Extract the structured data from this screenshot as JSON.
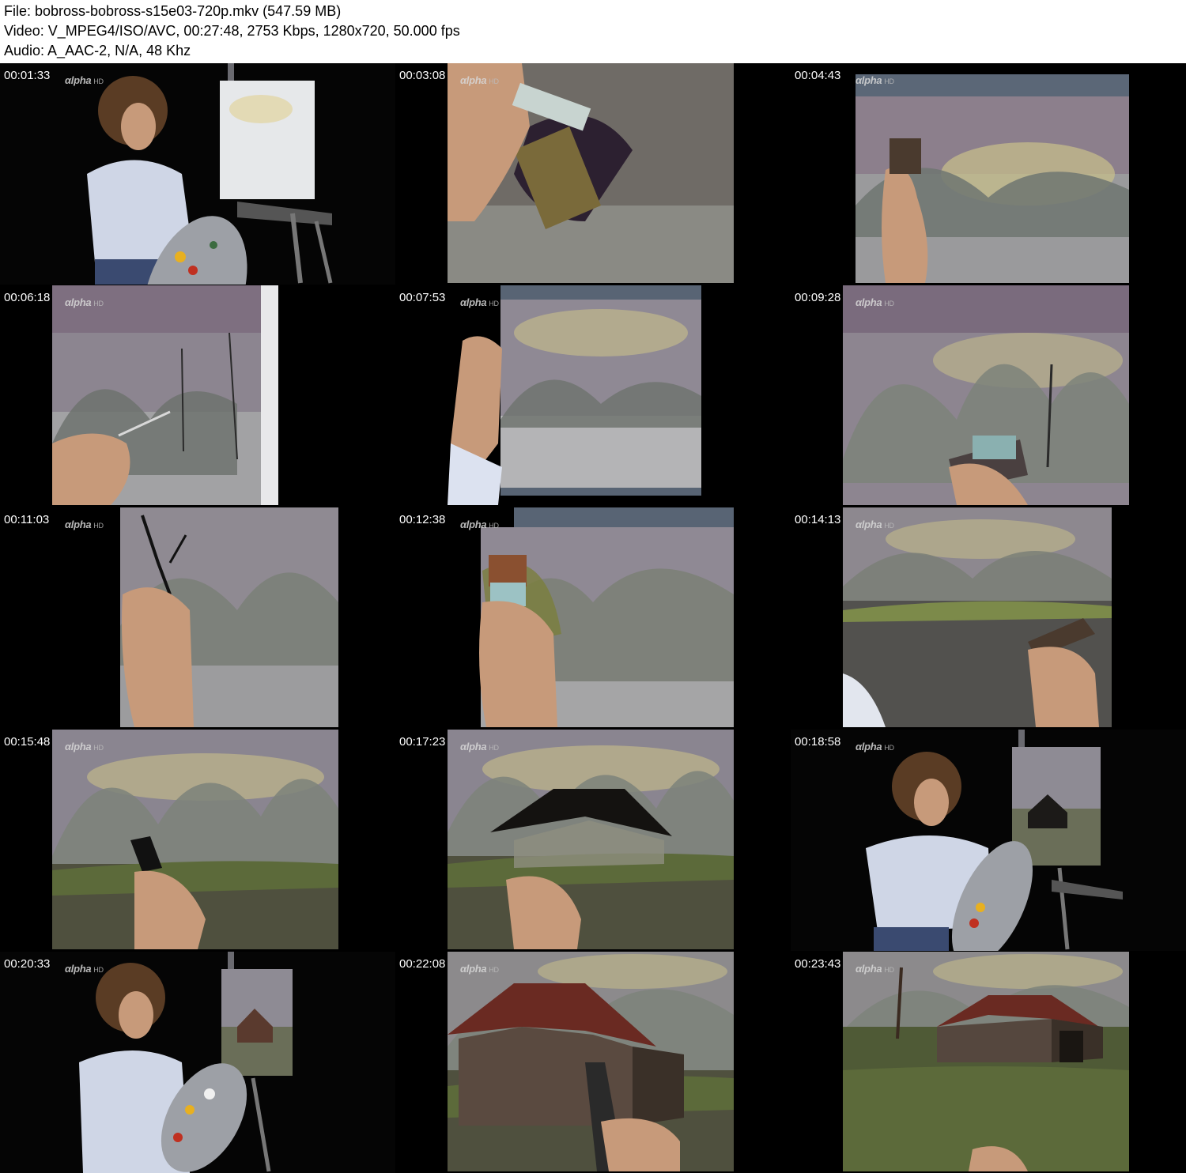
{
  "header": {
    "file": "File: bobross-bobross-s15e03-720p.mkv (547.59 MB)",
    "video": "Video: V_MPEG4/ISO/AVC, 00:27:48, 2753 Kbps, 1280x720, 50.000 fps",
    "audio": "Audio: A_AAC-2, N/A, 48 Khz"
  },
  "logo": {
    "text": "αlpha",
    "suffix": "HD"
  },
  "thumbnails": [
    {
      "timestamp": "00:01:33",
      "scene": "painter-at-easel"
    },
    {
      "timestamp": "00:03:08",
      "scene": "brush-closeup"
    },
    {
      "timestamp": "00:04:43",
      "scene": "canvas-sky-brush"
    },
    {
      "timestamp": "00:06:18",
      "scene": "canvas-trees-knife"
    },
    {
      "timestamp": "00:07:53",
      "scene": "canvas-trees-brush"
    },
    {
      "timestamp": "00:09:28",
      "scene": "canvas-trees-fan"
    },
    {
      "timestamp": "00:11:03",
      "scene": "canvas-tree-trunk"
    },
    {
      "timestamp": "00:12:38",
      "scene": "canvas-foliage"
    },
    {
      "timestamp": "00:14:13",
      "scene": "canvas-ground"
    },
    {
      "timestamp": "00:15:48",
      "scene": "canvas-barn-start"
    },
    {
      "timestamp": "00:17:23",
      "scene": "canvas-barn-roof"
    },
    {
      "timestamp": "00:18:58",
      "scene": "painter-with-barn"
    },
    {
      "timestamp": "00:20:33",
      "scene": "painter-palette"
    },
    {
      "timestamp": "00:22:08",
      "scene": "barn-closeup"
    },
    {
      "timestamp": "00:23:43",
      "scene": "barn-finished"
    }
  ],
  "colors": {
    "background": "#000000",
    "header_bg": "#ffffff",
    "sky_purple": "#8c7f8c",
    "sky_yellow": "#c9c08a",
    "tree_gray": "#7d827a",
    "grass_green": "#5c6a3a",
    "barn_brown": "#5a3a2e",
    "skin": "#c79a7a",
    "shirt": "#cfd6e6",
    "hair": "#5a3c24"
  }
}
